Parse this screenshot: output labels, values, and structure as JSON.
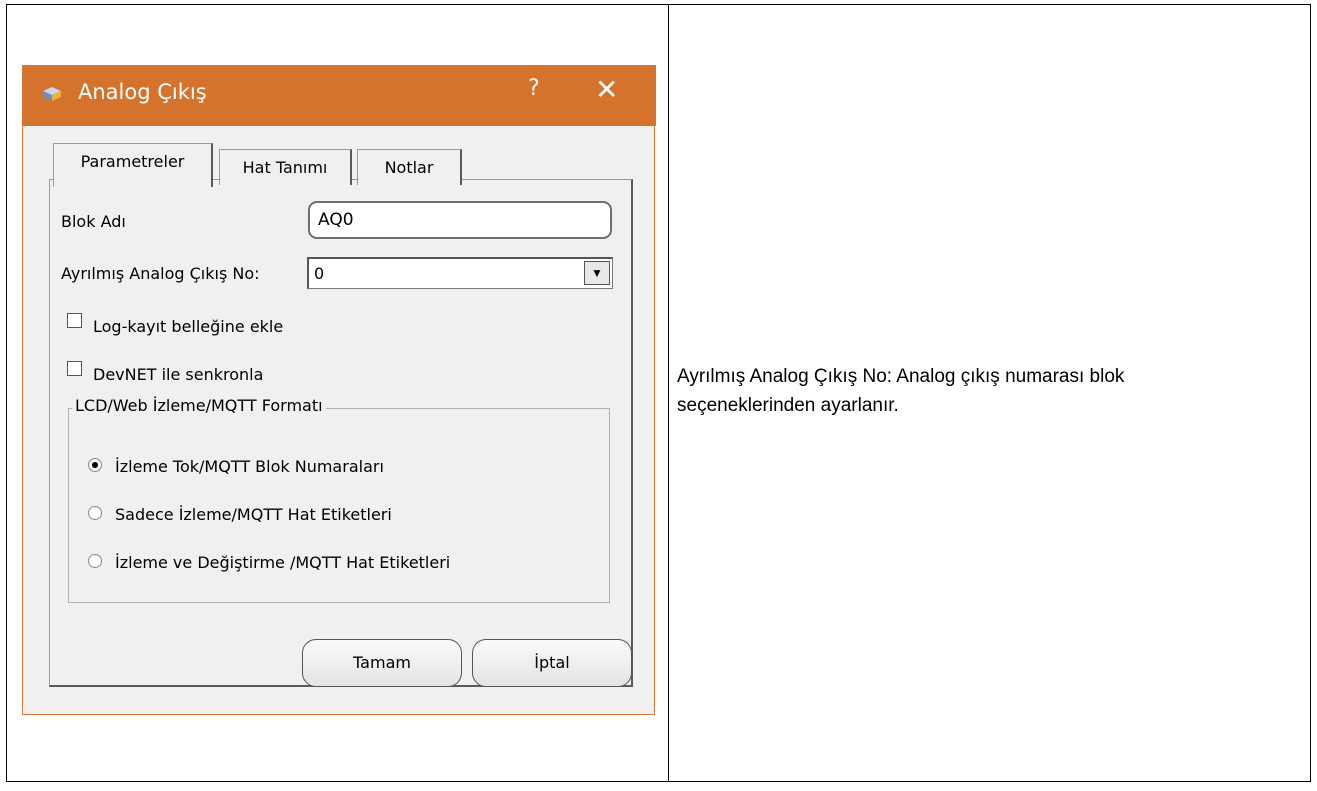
{
  "dialog": {
    "title": "Analog Çıkış",
    "help_label": "?",
    "close_label": "✕",
    "tabs": [
      {
        "label": "Parametreler",
        "active": true
      },
      {
        "label": "Hat Tanımı",
        "active": false
      },
      {
        "label": "Notlar",
        "active": false
      }
    ],
    "block_name": {
      "label": "Blok Adı",
      "value": "AQ0"
    },
    "reserved_output": {
      "label": "Ayrılmış Analog Çıkış No:",
      "selected": "0"
    },
    "checkboxes": [
      {
        "label": "Log-kayıt belleğine ekle",
        "checked": false
      },
      {
        "label": "DevNET ile senkronla",
        "checked": false
      }
    ],
    "format_group": {
      "title": "LCD/Web İzleme/MQTT Formatı",
      "options": [
        {
          "label": "İzleme Tok/MQTT Blok Numaraları",
          "selected": true
        },
        {
          "label": "Sadece İzleme/MQTT Hat Etiketleri",
          "selected": false
        },
        {
          "label": "İzleme ve Değiştirme /MQTT Hat Etiketleri",
          "selected": false
        }
      ]
    },
    "ok_label": "Tamam",
    "cancel_label": "İptal"
  },
  "description": {
    "line1": "Ayrılmış Analog Çıkış No:  Analog çıkış numarası blok",
    "line2": "seçeneklerinden ayarlanır."
  },
  "colors": {
    "titlebar": "#d5732c",
    "dialog_bg": "#f0f0f0"
  }
}
